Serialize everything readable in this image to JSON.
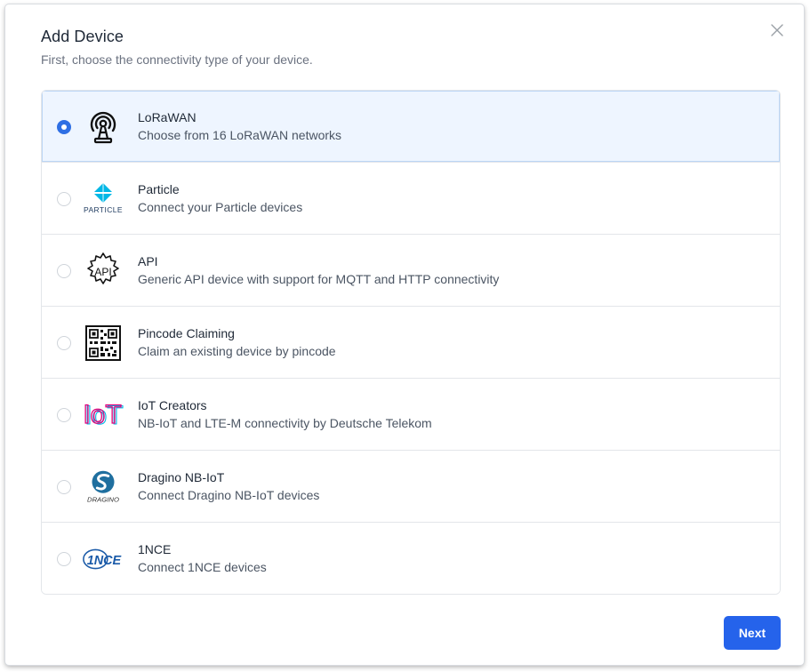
{
  "dialog": {
    "title": "Add Device",
    "subtitle": "First, choose the connectivity type of your device.",
    "next_label": "Next",
    "close_icon": "close-icon"
  },
  "options": [
    {
      "id": "lorawan",
      "title": "LoRaWAN",
      "description": "Choose from 16 LoRaWAN networks",
      "selected": true,
      "icon": "antenna-icon"
    },
    {
      "id": "particle",
      "title": "Particle",
      "description": "Connect your Particle devices",
      "selected": false,
      "icon": "particle-logo",
      "logo_text": "PARTICLE"
    },
    {
      "id": "api",
      "title": "API",
      "description": "Generic API device with support for MQTT and HTTP connectivity",
      "selected": false,
      "icon": "api-gear-icon",
      "logo_text": "API"
    },
    {
      "id": "pincode",
      "title": "Pincode Claiming",
      "description": "Claim an existing device by pincode",
      "selected": false,
      "icon": "qr-code-icon"
    },
    {
      "id": "iot-creators",
      "title": "IoT Creators",
      "description": "NB-IoT and LTE-M connectivity by Deutsche Telekom",
      "selected": false,
      "icon": "iot-creators-logo",
      "logo_text": "IoT"
    },
    {
      "id": "dragino",
      "title": "Dragino NB-IoT",
      "description": "Connect Dragino NB-IoT devices",
      "selected": false,
      "icon": "dragino-logo",
      "logo_text": "DRAGINO"
    },
    {
      "id": "1nce",
      "title": "1NCE",
      "description": "Connect 1NCE devices",
      "selected": false,
      "icon": "1nce-logo",
      "logo_text": "1NCE"
    }
  ],
  "colors": {
    "accent": "#2563eb",
    "selected_bg": "#eef5ff",
    "particle": "#00b7e6",
    "iot_pink": "#e2007a",
    "dragino": "#1f6f9f",
    "nce": "#1a5aa8"
  }
}
